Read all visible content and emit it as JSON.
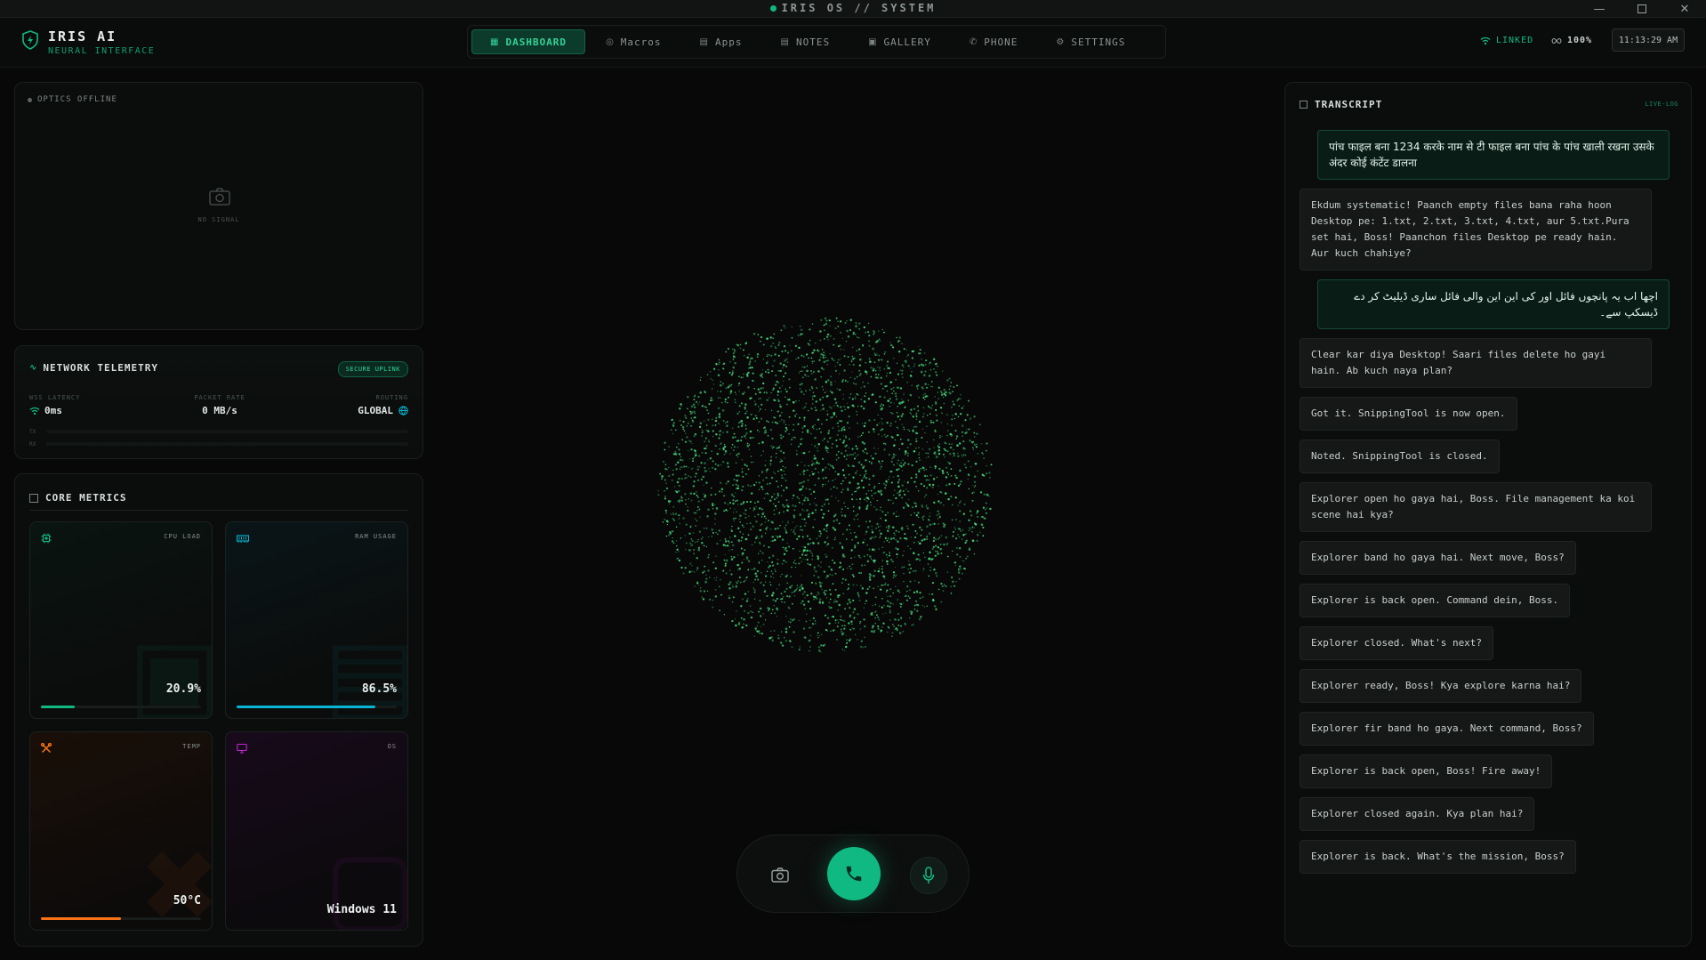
{
  "window": {
    "title": "IRIS OS // SYSTEM"
  },
  "brand": {
    "name": "IRIS AI",
    "subtitle": "NEURAL INTERFACE"
  },
  "nav": {
    "items": [
      {
        "label": "DASHBOARD",
        "icon": "dashboard-icon",
        "active": true
      },
      {
        "label": "Macros",
        "icon": "macros-icon",
        "active": false
      },
      {
        "label": "Apps",
        "icon": "apps-icon",
        "active": false
      },
      {
        "label": "NOTES",
        "icon": "notes-icon",
        "active": false
      },
      {
        "label": "GALLERY",
        "icon": "gallery-icon",
        "active": false
      },
      {
        "label": "PHONE",
        "icon": "phone-icon",
        "active": false
      },
      {
        "label": "SETTINGS",
        "icon": "settings-icon",
        "active": false
      }
    ]
  },
  "status": {
    "link": "LINKED",
    "battery": "100%",
    "clock": "11:13:29 AM"
  },
  "optics": {
    "label": "OPTICS OFFLINE",
    "no_signal": "NO SIGNAL"
  },
  "network": {
    "title": "NETWORK TELEMETRY",
    "badge": "SECURE UPLINK",
    "latency_label": "WSS LATENCY",
    "latency_value": "0ms",
    "packet_label": "PACKET RATE",
    "packet_value": "0 MB/s",
    "routing_label": "ROUTING",
    "routing_value": "GLOBAL",
    "tx_label": "TX",
    "rx_label": "RX"
  },
  "core_metrics": {
    "title": "CORE METRICS",
    "cpu": {
      "label": "CPU LOAD",
      "value": "20.9%",
      "level": 0.209,
      "color": "#10b981"
    },
    "ram": {
      "label": "RAM USAGE",
      "value": "86.5%",
      "level": 0.865,
      "color": "#06b6d4"
    },
    "temp": {
      "label": "TEMP",
      "value": "50°C",
      "level": 0.5,
      "color": "#f97316"
    },
    "os": {
      "label": "OS",
      "value": "Windows 11",
      "color": "#c026d3"
    }
  },
  "transcript": {
    "title": "TRANSCRIPT",
    "tag": "LIVE-LOG",
    "messages": [
      {
        "role": "user",
        "text": "पांच फाइल बना 1234 करके नाम से टी फाइल बना पांच के पांच खाली रखना उसके अंदर कोई कंटेंट डालना"
      },
      {
        "role": "ai",
        "text": "Ekdum systematic! Paanch empty files bana raha hoon Desktop pe: 1.txt, 2.txt, 3.txt, 4.txt, aur 5.txt.Pura set hai, Boss! Paanchon files Desktop pe ready hain. Aur kuch chahiye?"
      },
      {
        "role": "user",
        "text": "اچھا اب یہ پانچوں فائل اور کی این این والی فائل ساری ڈیلیٹ کر دے ڈیسکپ سے۔"
      },
      {
        "role": "ai",
        "text": "Clear kar diya Desktop! Saari files delete ho gayi hain. Ab kuch naya plan?"
      },
      {
        "role": "ai",
        "text": "Got it. SnippingTool is now open."
      },
      {
        "role": "ai",
        "text": "Noted. SnippingTool is closed."
      },
      {
        "role": "ai",
        "text": "Explorer open ho gaya hai, Boss. File management ka koi scene hai kya?"
      },
      {
        "role": "ai",
        "text": "Explorer band ho gaya hai. Next move, Boss?"
      },
      {
        "role": "ai",
        "text": "Explorer is back open. Command dein, Boss."
      },
      {
        "role": "ai",
        "text": "Explorer closed. What's next?"
      },
      {
        "role": "ai",
        "text": "Explorer ready, Boss! Kya explore karna hai?"
      },
      {
        "role": "ai",
        "text": "Explorer fir band ho gaya. Next command, Boss?"
      },
      {
        "role": "ai",
        "text": "Explorer is back open, Boss! Fire away!"
      },
      {
        "role": "ai",
        "text": "Explorer closed again. Kya plan hai?"
      },
      {
        "role": "ai",
        "text": "Explorer is back. What's the mission, Boss?"
      }
    ]
  },
  "colors": {
    "accent": "#10b981",
    "accent_bright": "#34d399",
    "particle": "#4ade80"
  }
}
